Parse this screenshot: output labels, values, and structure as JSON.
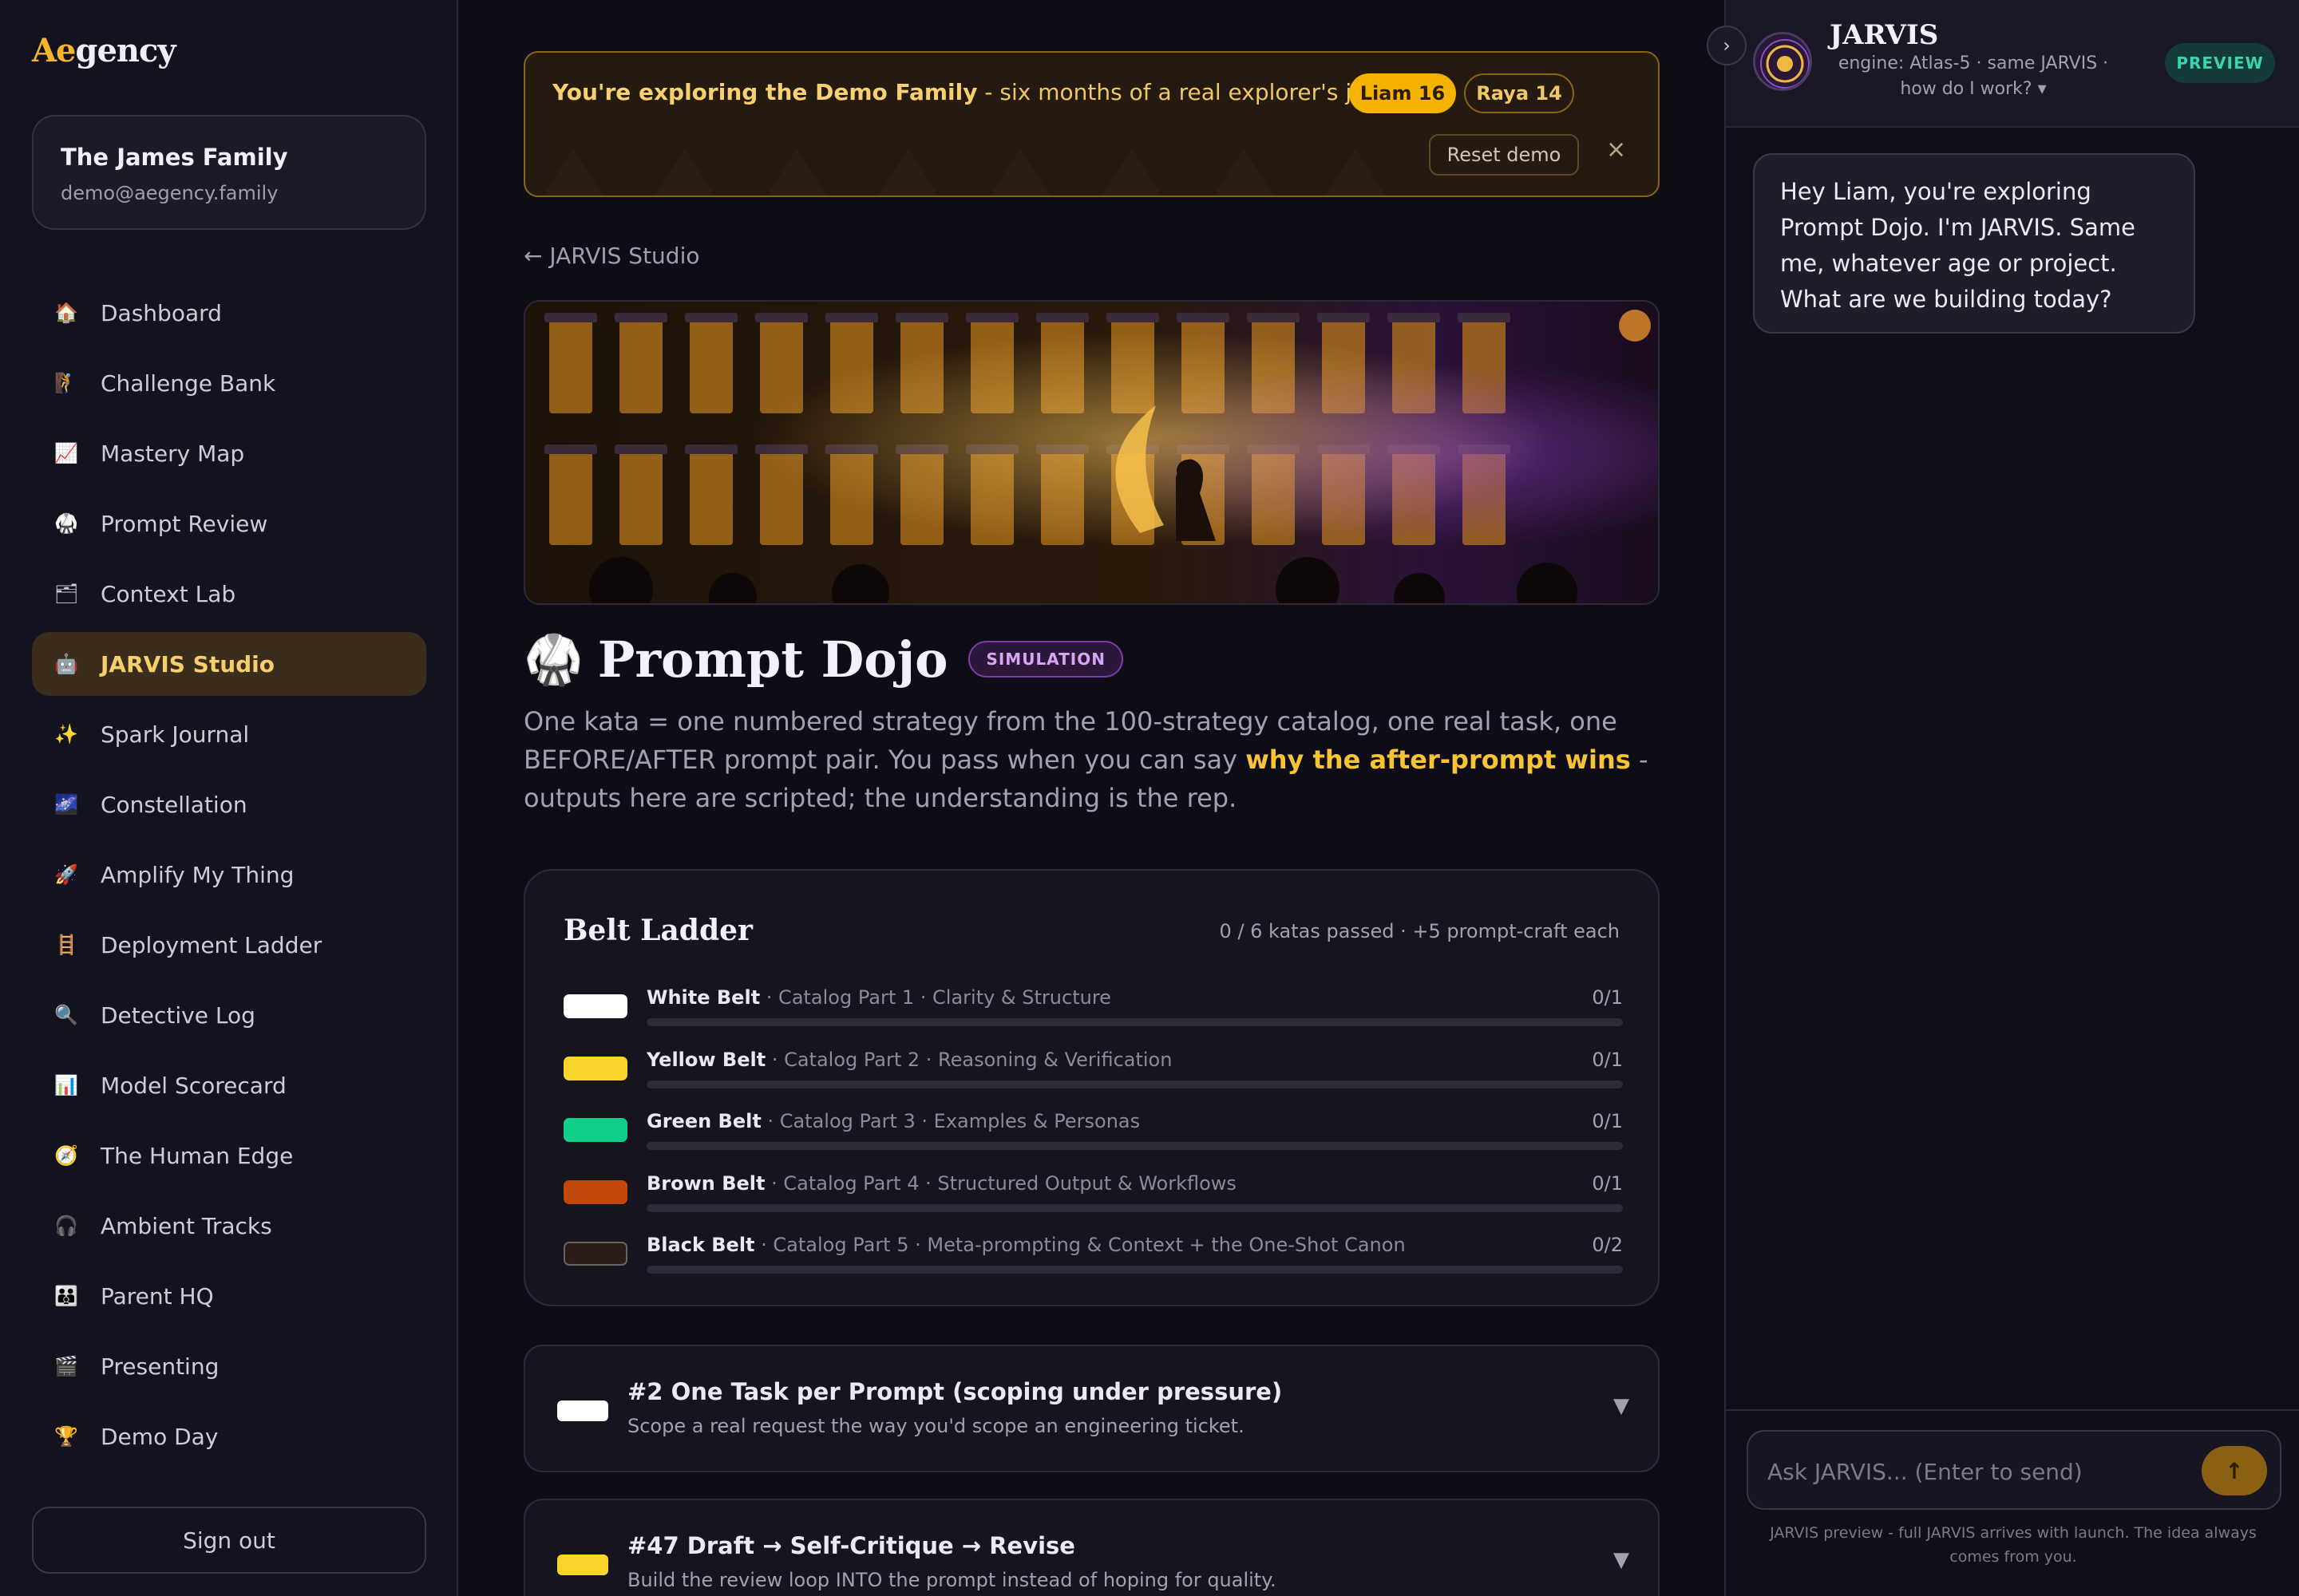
{
  "brand": {
    "logo_prefix": "Ae",
    "logo_suffix": "gency"
  },
  "family": {
    "name": "The James Family",
    "email": "demo@aegency.family"
  },
  "nav": [
    {
      "icon": "house-icon",
      "glyph": "🏠",
      "label": "Dashboard"
    },
    {
      "icon": "climber-icon",
      "glyph": "🧗",
      "label": "Challenge Bank"
    },
    {
      "icon": "chart-up-icon",
      "glyph": "📈",
      "label": "Mastery Map"
    },
    {
      "icon": "gi-icon",
      "glyph": "🥋",
      "label": "Prompt Review"
    },
    {
      "icon": "folder-icon",
      "glyph": "🗂",
      "label": "Context Lab"
    },
    {
      "icon": "robot-icon",
      "glyph": "🤖",
      "label": "JARVIS Studio"
    },
    {
      "icon": "sparkles-icon",
      "glyph": "✨",
      "label": "Spark Journal"
    },
    {
      "icon": "night-sky-icon",
      "glyph": "🌌",
      "label": "Constellation"
    },
    {
      "icon": "rocket-icon",
      "glyph": "🚀",
      "label": "Amplify My Thing"
    },
    {
      "icon": "ladder-icon",
      "glyph": "🪜",
      "label": "Deployment Ladder"
    },
    {
      "icon": "magnifier-icon",
      "glyph": "🔍",
      "label": "Detective Log"
    },
    {
      "icon": "bar-chart-icon",
      "glyph": "📊",
      "label": "Model Scorecard"
    },
    {
      "icon": "compass-icon",
      "glyph": "🧭",
      "label": "The Human Edge"
    },
    {
      "icon": "headphones-icon",
      "glyph": "🎧",
      "label": "Ambient Tracks"
    },
    {
      "icon": "family-icon",
      "glyph": "👪",
      "label": "Parent HQ"
    },
    {
      "icon": "clapper-icon",
      "glyph": "🎬",
      "label": "Presenting"
    },
    {
      "icon": "trophy-icon",
      "glyph": "🏆",
      "label": "Demo Day"
    }
  ],
  "active_nav": "JARVIS Studio",
  "signout": "Sign out",
  "banner": {
    "strong": "You're exploring the Demo Family",
    "rest": " - six months of a real explorer's journey",
    "chips": [
      "Liam 16",
      "Raya 14"
    ],
    "reset": "Reset demo",
    "close": "×"
  },
  "back_link": "← JARVIS Studio",
  "page": {
    "icon": "🥋",
    "title": "Prompt Dojo",
    "badge": "SIMULATION",
    "desc_before": "One kata = one numbered strategy from the 100-strategy catalog, one real task, one BEFORE/AFTER prompt pair. You pass when you can say ",
    "desc_highlight": "why the after-prompt wins",
    "desc_after": " - outputs here are scripted; the understanding is the rep."
  },
  "ladder": {
    "title": "Belt Ladder",
    "meta": "0 / 6 katas passed · +5 prompt-craft each",
    "belts": [
      {
        "name": "White Belt",
        "detail": " · Catalog Part 1 · Clarity & Structure",
        "count": "0/1",
        "color": "#ffffff",
        "progress": 0
      },
      {
        "name": "Yellow Belt",
        "detail": " · Catalog Part 2 · Reasoning & Verification",
        "count": "0/1",
        "color": "#f8d52a",
        "progress": 0
      },
      {
        "name": "Green Belt",
        "detail": " · Catalog Part 3 · Examples & Personas",
        "count": "0/1",
        "color": "#0fcf8a",
        "progress": 0
      },
      {
        "name": "Brown Belt",
        "detail": " · Catalog Part 4 · Structured Output & Workflows",
        "count": "0/1",
        "color": "#c2470a",
        "progress": 0
      },
      {
        "name": "Black Belt",
        "detail": " · Catalog Part 5 · Meta-prompting & Context + the One-Shot Canon",
        "count": "0/2",
        "color": "#2a1d1a",
        "progress": 0
      }
    ]
  },
  "katas": [
    {
      "title": "#2 One Task per Prompt (scoping under pressure)",
      "sub": "Scope a real request the way you'd scope an engineering ticket.",
      "color": "#ffffff"
    },
    {
      "title": "#47 Draft → Self-Critique → Revise",
      "sub": "Build the review loop INTO the prompt instead of hoping for quality.",
      "color": "#f8d52a"
    }
  ],
  "jarvis": {
    "name": "JARVIS",
    "engine": "engine: Atlas-5 · same JARVIS · how do I work? ▾",
    "badge": "PREVIEW",
    "toggle": "›",
    "message": "Hey Liam, you're exploring Prompt Dojo. I'm JARVIS. Same me, whatever age or project. What are we building today?",
    "input_placeholder": "Ask JARVIS... (Enter to send)",
    "send": "↑",
    "note": "JARVIS preview - full JARVIS arrives with launch. The idea always comes from you."
  }
}
